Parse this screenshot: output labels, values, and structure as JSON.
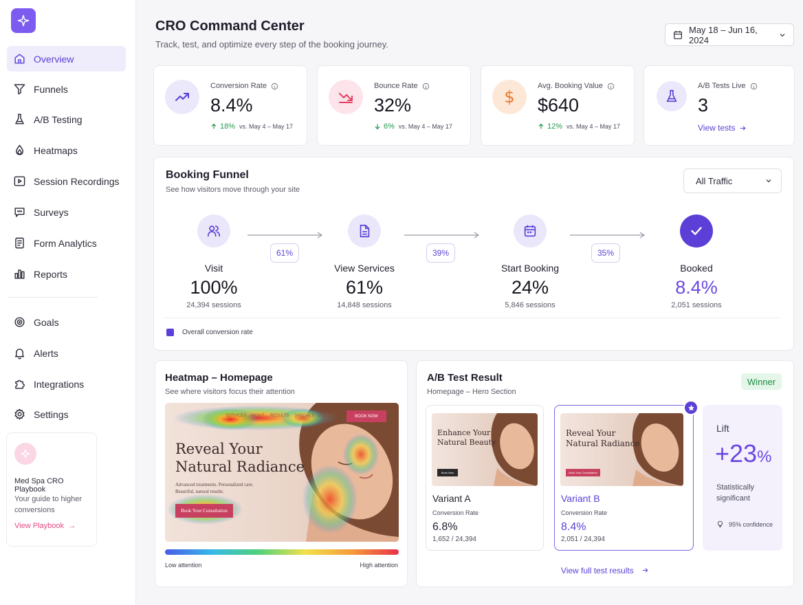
{
  "sidebar": {
    "items": [
      {
        "label": "Overview",
        "icon": "home-icon"
      },
      {
        "label": "Funnels",
        "icon": "funnel-icon"
      },
      {
        "label": "A/B Testing",
        "icon": "flask-icon"
      },
      {
        "label": "Heatmaps",
        "icon": "flame-icon"
      },
      {
        "label": "Session Recordings",
        "icon": "play-icon"
      },
      {
        "label": "Surveys",
        "icon": "chat-icon"
      },
      {
        "label": "Form Analytics",
        "icon": "form-icon"
      },
      {
        "label": "Reports",
        "icon": "bar-chart-icon"
      },
      {
        "label": "Goals",
        "icon": "target-icon"
      },
      {
        "label": "Alerts",
        "icon": "bell-icon"
      },
      {
        "label": "Integrations",
        "icon": "puzzle-icon"
      },
      {
        "label": "Settings",
        "icon": "gear-icon"
      }
    ],
    "active": "Overview",
    "playbook": {
      "title": "Med Spa CRO Playbook",
      "subtitle": "Your guide to higher conversions",
      "link": "View Playbook"
    }
  },
  "header": {
    "title": "CRO Command Center",
    "subtitle": "Track, test, and optimize every step of the booking journey.",
    "date_range": "May 18 – Jun 16, 2024"
  },
  "kpis": [
    {
      "label": "Conversion Rate",
      "value": "8.4%",
      "delta": "18%",
      "direction": "up",
      "compare": "vs. May 4 – May 17",
      "icon": "trend-up-icon"
    },
    {
      "label": "Bounce Rate",
      "value": "32%",
      "delta": "6%",
      "direction": "down",
      "compare": "vs. May 4 – May 17",
      "icon": "trend-down-icon"
    },
    {
      "label": "Avg. Booking Value",
      "value": "$640",
      "delta": "12%",
      "direction": "up",
      "compare": "vs. May 4 – May 17",
      "icon": "dollar-icon"
    },
    {
      "label": "A/B Tests Live",
      "value": "3",
      "link": "View tests",
      "icon": "flask-icon"
    }
  ],
  "funnel": {
    "title": "Booking Funnel",
    "subtitle": "See how visitors move through your site",
    "filter": "All Traffic",
    "stages": [
      {
        "name": "Visit",
        "percent": "100%",
        "sessions": "24,394 sessions"
      },
      {
        "name": "View Services",
        "percent": "61%",
        "sessions": "14,848 sessions"
      },
      {
        "name": "Start Booking",
        "percent": "24%",
        "sessions": "5,846 sessions"
      },
      {
        "name": "Booked",
        "percent": "8.4%",
        "sessions": "2,051 sessions"
      }
    ],
    "step_rates": [
      "61%",
      "39%",
      "35%"
    ],
    "legend": "Overall conversion rate",
    "accent": "#5b3fd6"
  },
  "heatmap": {
    "title": "Heatmap – Homepage",
    "subtitle": "See where visitors focus their attention",
    "preview": {
      "nav": [
        "SERVICES",
        "ABOUT",
        "RESULTS",
        "SPECIALS",
        "CONTACT"
      ],
      "nav_button": "BOOK NOW",
      "headline_1": "Reveal Your",
      "headline_2": "Natural Radiance",
      "body_1": "Advanced treatments. Personalized care.",
      "body_2": "Beautiful, natural results.",
      "cta": "Book Your Consultation"
    },
    "low_label": "Low attention",
    "high_label": "High attention"
  },
  "ab_test": {
    "title": "A/B Test Result",
    "subtitle": "Homepage – Hero Section",
    "badge": "Winner",
    "variants": [
      {
        "name": "Variant A",
        "headline_1": "Enhance Your",
        "headline_2": "Natural Beauty",
        "button": "Book Now",
        "rate_label": "Conversion Rate",
        "rate": "6.8%",
        "count": "1,652 / 24,394"
      },
      {
        "name": "Variant B",
        "headline_1": "Reveal Your",
        "headline_2": "Natural Radiance",
        "button": "Book Your Consultation",
        "rate_label": "Conversion Rate",
        "rate": "8.4%",
        "count": "2,051 / 24,394"
      }
    ],
    "lift": {
      "label": "Lift",
      "value": "+23",
      "unit": "%",
      "note": "Statistically significant",
      "confidence": "95% confidence"
    },
    "link": "View full test results"
  },
  "colors": {
    "brand": "#7c5cf0",
    "accent": "#5b3fd6",
    "up": "#1f9a4f",
    "down": "#1f9a4f",
    "pink": "#e04a82"
  }
}
